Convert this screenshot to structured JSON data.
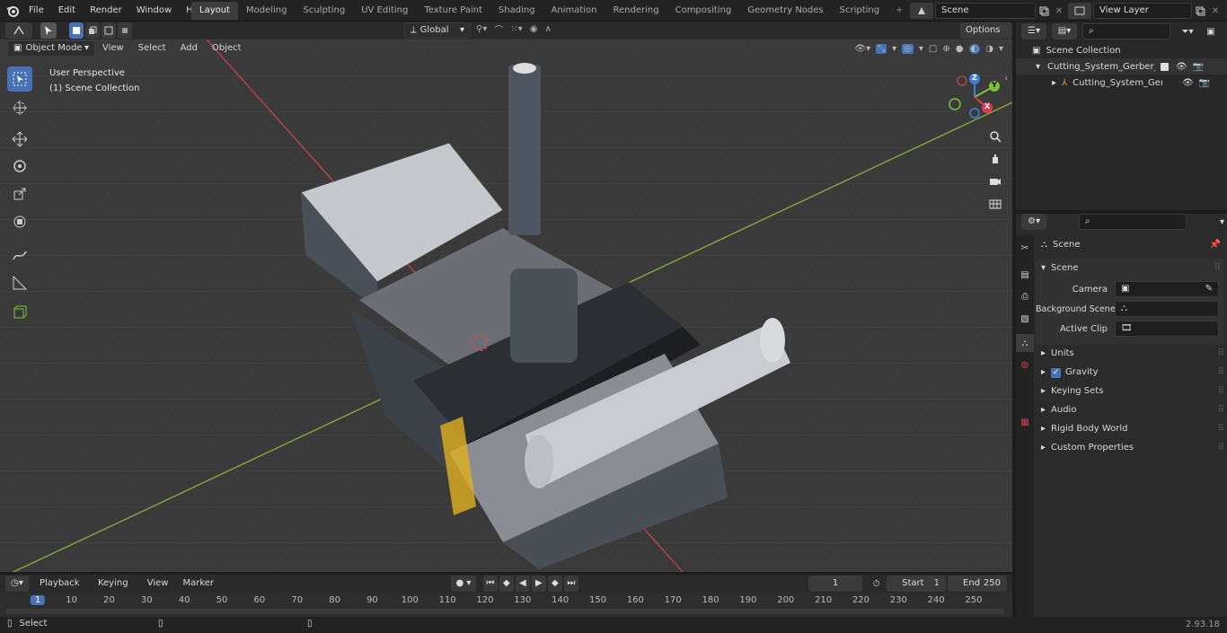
{
  "topbar": {
    "menus": [
      "File",
      "Edit",
      "Render",
      "Window",
      "Help"
    ],
    "workspaces": [
      "Layout",
      "Modeling",
      "Sculpting",
      "UV Editing",
      "Texture Paint",
      "Shading",
      "Animation",
      "Rendering",
      "Compositing",
      "Geometry Nodes",
      "Scripting"
    ],
    "active_workspace": "Layout",
    "scene_name": "Scene",
    "view_layer": "View Layer"
  },
  "viewport_header": {
    "mode": "Object Mode",
    "menus": [
      "View",
      "Select",
      "Add",
      "Object"
    ],
    "orientation": "Global",
    "options_label": "Options"
  },
  "viewport": {
    "perspective_label": "User Perspective",
    "collection_label": "(1) Scene Collection",
    "gizmo_axes": [
      "Z",
      "Y",
      "X"
    ]
  },
  "outliner": {
    "root": "Scene Collection",
    "items": [
      {
        "label": "Cutting_System_Gerber_Para"
      },
      {
        "label": "Cutting_System_Gerber_"
      }
    ]
  },
  "properties": {
    "header": "Scene",
    "panel": "Scene",
    "fields": [
      {
        "label": "Camera"
      },
      {
        "label": "Background Scene"
      },
      {
        "label": "Active Clip"
      }
    ],
    "sections": [
      "Units",
      "Gravity",
      "Keying Sets",
      "Audio",
      "Rigid Body World",
      "Custom Properties"
    ]
  },
  "timeline": {
    "menus": [
      "Playback",
      "Keying",
      "View",
      "Marker"
    ],
    "current_frame": "1",
    "start_label": "Start",
    "start": "1",
    "end_label": "End",
    "end": "250",
    "ticks": [
      "1",
      "10",
      "20",
      "30",
      "40",
      "50",
      "60",
      "70",
      "80",
      "90",
      "100",
      "110",
      "120",
      "130",
      "140",
      "150",
      "160",
      "170",
      "180",
      "190",
      "200",
      "210",
      "220",
      "230",
      "240",
      "250"
    ]
  },
  "statusbar": {
    "left_label": "Select",
    "version": "2.93.18"
  },
  "colors": {
    "accent": "#4772b3",
    "axis_x": "#e03a50",
    "axis_y": "#7fbf3b",
    "axis_z": "#3b7fe0"
  }
}
